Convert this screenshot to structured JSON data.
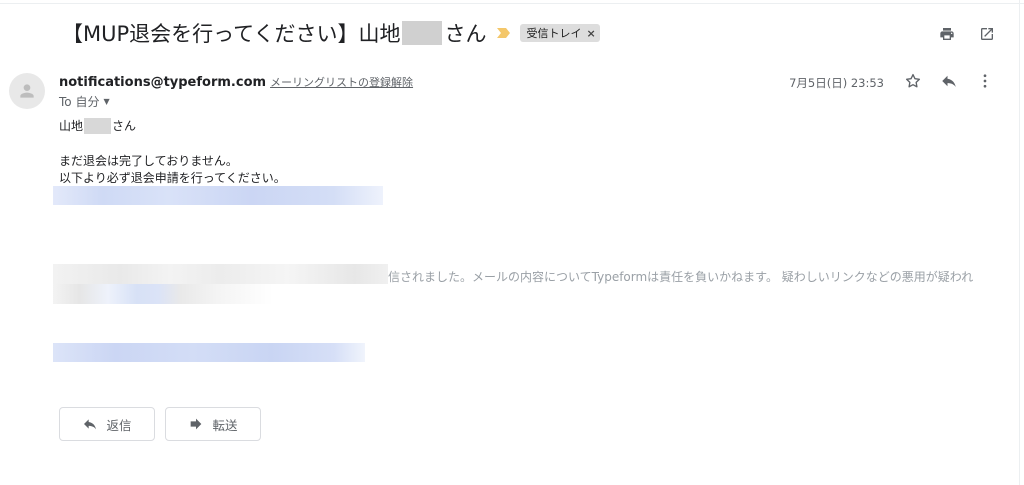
{
  "subject": {
    "prefix": "【MUP退会を行ってください】山地",
    "suffix": "さん"
  },
  "label_chip": {
    "label": "受信トレイ",
    "close": "×"
  },
  "icons": {
    "important": "importance-marker-icon",
    "print": "print-icon",
    "new_window": "open-in-new-window-icon",
    "avatar": "person-icon",
    "star": "star-icon",
    "reply": "reply-icon",
    "more": "more-vert-icon",
    "forward": "forward-icon"
  },
  "sender": {
    "email": "notifications@typeform.com",
    "unsubscribe": "メーリングリストの登録解除"
  },
  "recipient": {
    "text": "To 自分"
  },
  "date": "7月5日(日) 23:53",
  "body": {
    "greeting_prefix": "山地",
    "greeting_suffix": "さん",
    "line1": "まだ退会は完了しておりません。",
    "line2": "以下より必ず退会申請を行ってください。",
    "notice": "信されました。メールの内容についてTypeformは責任を負いかねます。 疑わしいリンクなどの悪用が疑われ"
  },
  "buttons": {
    "reply": "返信",
    "forward": "転送"
  },
  "colors": {
    "important": "#f4c76a",
    "link_blur": "#d2dcf6",
    "chip_bg": "#dddddd"
  }
}
